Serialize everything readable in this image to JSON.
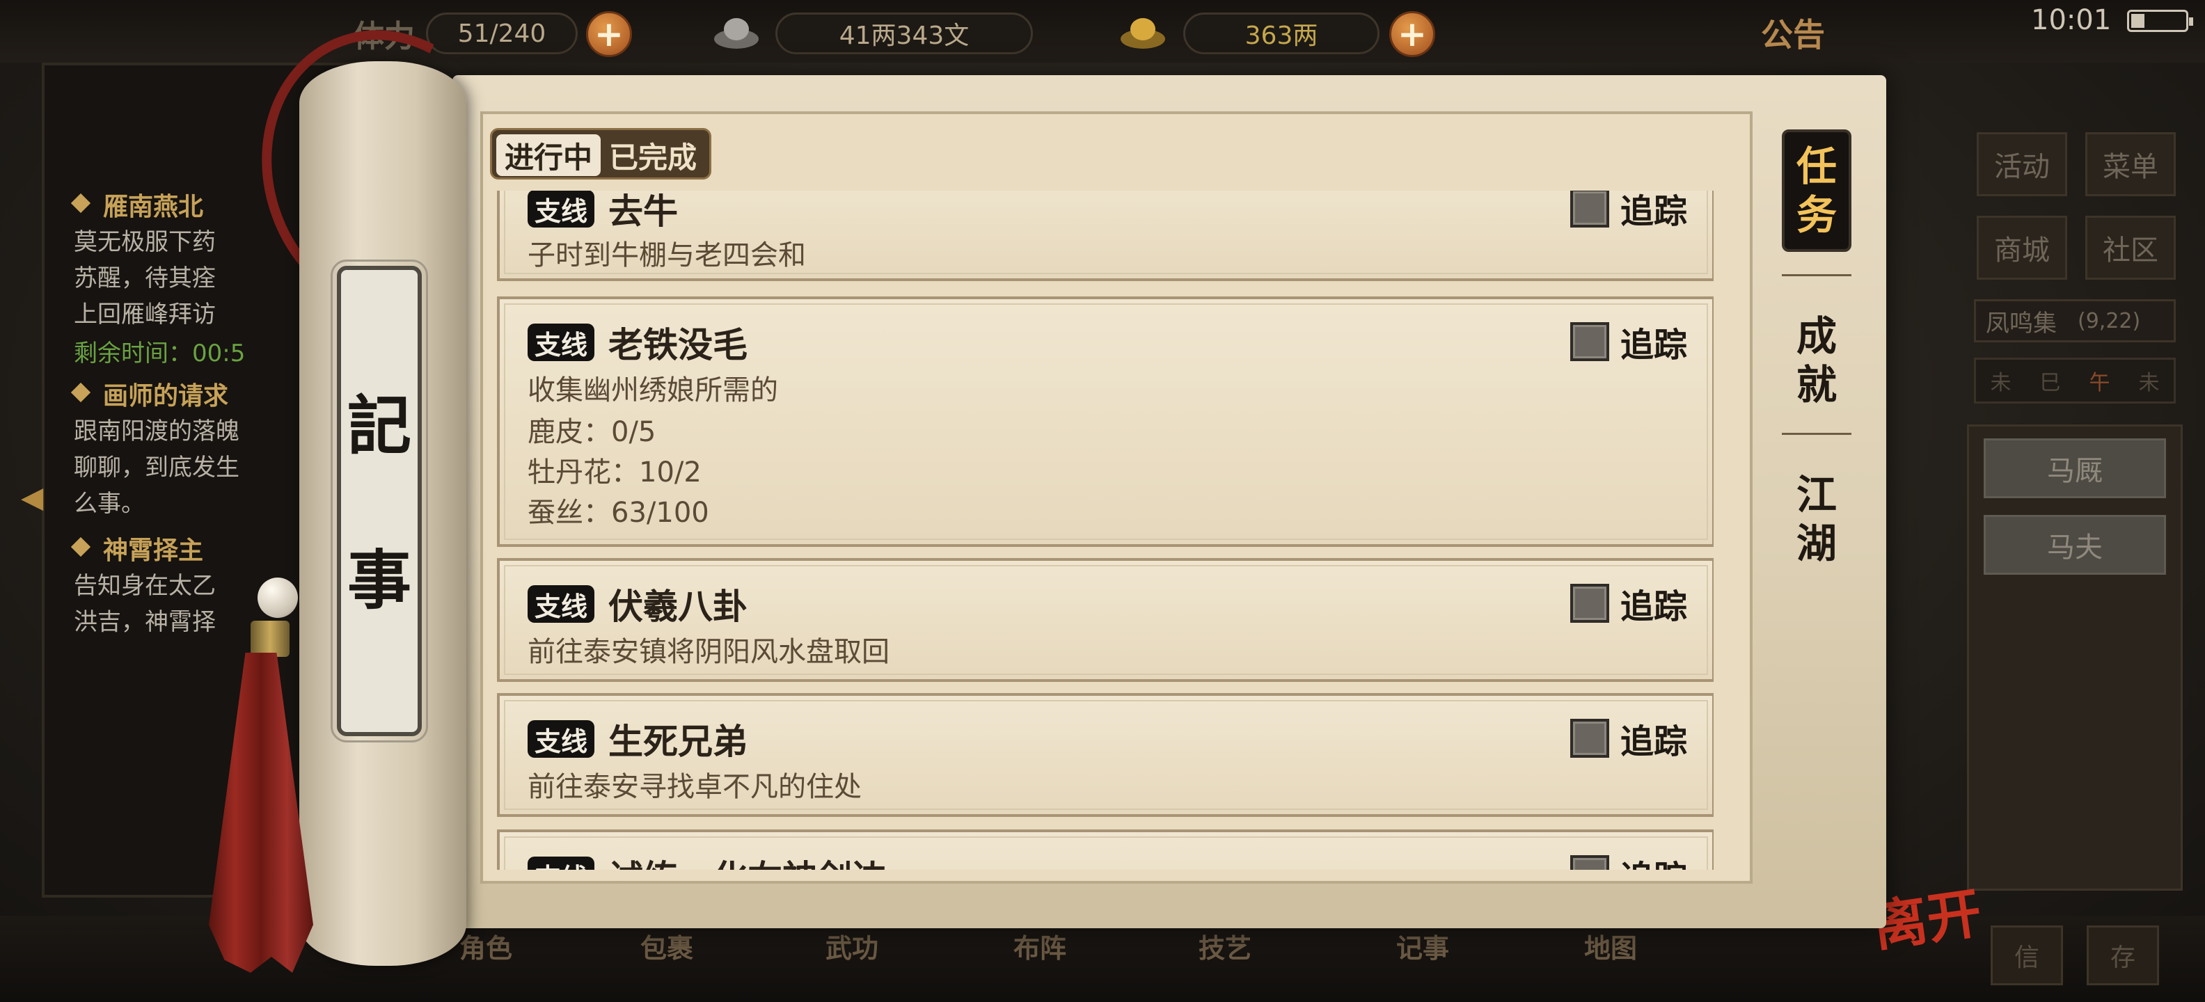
{
  "top_bar": {
    "stamina_label": "体力",
    "stamina_value": "51/240",
    "money_value": "41两343文",
    "gold_value": "363两",
    "notice_label": "公告",
    "time": "10:01",
    "battery_percent": 0.25
  },
  "left_panel": {
    "quests": [
      {
        "title": "雁南燕北",
        "lines": [
          "莫无极服下药",
          "苏醒，待其痊",
          "上回雁峰拜访"
        ],
        "time": "剩余时间：00:5"
      },
      {
        "title": "画师的请求",
        "lines": [
          "跟南阳渡的落魄",
          "聊聊，到底发生",
          "么事。"
        ]
      },
      {
        "title": "神霄择主",
        "lines": [
          "告知身在太乙",
          "洪吉，神霄择"
        ]
      }
    ]
  },
  "scroll": {
    "roll_label": [
      "記",
      "事"
    ],
    "tabs": [
      {
        "label": "进行中",
        "active": true
      },
      {
        "label": "已完成",
        "active": false
      }
    ],
    "side_tabs": [
      {
        "label": [
          "任",
          "务"
        ],
        "active": true
      },
      {
        "label": [
          "成",
          "就"
        ],
        "active": false
      },
      {
        "label": [
          "江",
          "湖"
        ],
        "active": false
      }
    ],
    "quests": [
      {
        "badge": "支线",
        "title": "去牛",
        "track": "追踪",
        "lines": [
          "子时到牛棚与老四会和"
        ]
      },
      {
        "badge": "支线",
        "title": "老铁没毛",
        "track": "追踪",
        "lines": [
          "收集幽州绣娘所需的",
          "鹿皮：0/5",
          "牡丹花：10/2",
          "蚕丝：63/100"
        ]
      },
      {
        "badge": "支线",
        "title": "伏羲八卦",
        "track": "追踪",
        "lines": [
          "前往泰安镇将阴阳风水盘取回"
        ]
      },
      {
        "badge": "支线",
        "title": "生死兄弟",
        "track": "追踪",
        "lines": [
          "前往泰安寻找卓不凡的住处"
        ]
      },
      {
        "badge": "支线",
        "title": "试练，化右神剑边",
        "track": "追踪",
        "lines": []
      }
    ]
  },
  "right_panel": {
    "buttons": [
      "活动",
      "菜单",
      "商城",
      "社区"
    ],
    "map_name": "凤鸣集",
    "map_coords": "(9,22)",
    "compass": [
      "未",
      "巳",
      "午",
      "未"
    ],
    "npcs": [
      "马厩",
      "马夫"
    ]
  },
  "bottom_bar": {
    "items": [
      "角色",
      "包裹",
      "武功",
      "布阵",
      "技艺",
      "记事",
      "地图"
    ],
    "leave_label": "离开",
    "buttons": [
      "信",
      "存"
    ]
  },
  "colors": {
    "paper": "#e9dcc0",
    "ink": "#2b2219",
    "accent_gold": "#f3c35b",
    "quest_title_gold": "#c7a258",
    "time_green": "#6aa242",
    "leave_red": "#c9311f"
  }
}
